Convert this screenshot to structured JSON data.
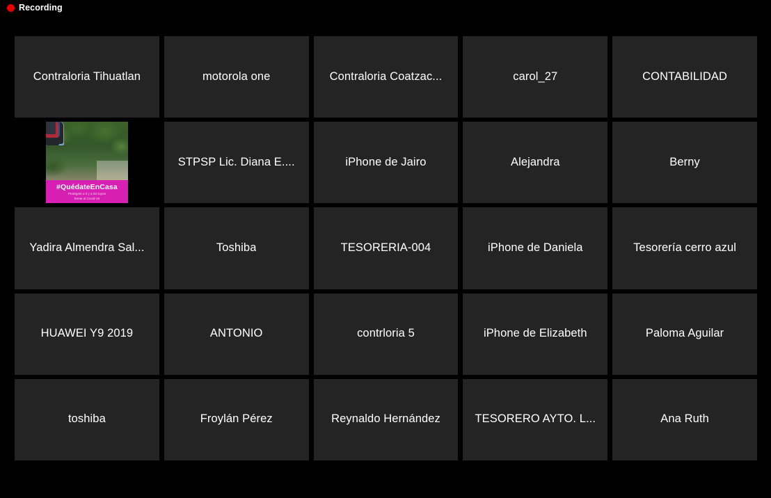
{
  "status_bar": {
    "recording_label": "Recording",
    "recording_dot_color": "#e60000"
  },
  "theme": {
    "page_background": "#000000",
    "tile_background": "#242424",
    "tile_text_color": "#ffffff",
    "banner_color": "#d81fb4"
  },
  "gallery": {
    "columns": 5,
    "rows": 5,
    "participants": [
      {
        "name": "Contraloria Tihuatlan",
        "type": "name"
      },
      {
        "name": "motorola one",
        "type": "name"
      },
      {
        "name": "Contraloria Coatzac...",
        "type": "name"
      },
      {
        "name": "carol_27",
        "type": "name"
      },
      {
        "name": "CONTABILIDAD",
        "type": "name"
      },
      {
        "name": "",
        "type": "photo",
        "photo": {
          "banner_title": "#QuédateEnCasa",
          "banner_subtitle_line1": "Protégete a ti y a los tuyos",
          "banner_subtitle_line2": "frente al Covid-19"
        }
      },
      {
        "name": "STPSP Lic. Diana E....",
        "type": "name"
      },
      {
        "name": "iPhone de Jairo",
        "type": "name"
      },
      {
        "name": "Alejandra",
        "type": "name"
      },
      {
        "name": "Berny",
        "type": "name"
      },
      {
        "name": "Yadira Almendra Sal...",
        "type": "name"
      },
      {
        "name": "Toshiba",
        "type": "name"
      },
      {
        "name": "TESORERIA-004",
        "type": "name"
      },
      {
        "name": "iPhone de Daniela",
        "type": "name"
      },
      {
        "name": "Tesorería cerro azul",
        "type": "name"
      },
      {
        "name": "HUAWEI Y9 2019",
        "type": "name"
      },
      {
        "name": "ANTONIO",
        "type": "name"
      },
      {
        "name": "contrloria 5",
        "type": "name"
      },
      {
        "name": "iPhone de Elizabeth",
        "type": "name"
      },
      {
        "name": "Paloma Aguilar",
        "type": "name"
      },
      {
        "name": "toshiba",
        "type": "name"
      },
      {
        "name": "Froylán Pérez",
        "type": "name"
      },
      {
        "name": "Reynaldo Hernández",
        "type": "name"
      },
      {
        "name": "TESORERO AYTO. L...",
        "type": "name"
      },
      {
        "name": "Ana Ruth",
        "type": "name"
      }
    ]
  }
}
